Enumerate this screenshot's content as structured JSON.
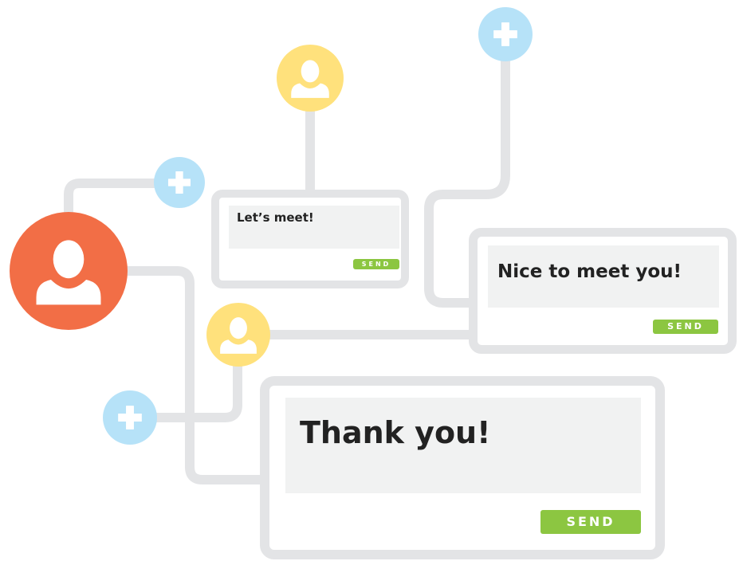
{
  "colors": {
    "connector": "#e3e4e6",
    "card_border": "#e3e4e6",
    "message_bg": "#f1f2f2",
    "send_button": "#8cc641",
    "main_avatar": "#f26e46",
    "contact_avatar": "#ffe17c",
    "add_node": "#b6e2f8"
  },
  "cards": [
    {
      "message": "Let’s meet!",
      "send_label": "SEND"
    },
    {
      "message": "Nice to meet you!",
      "send_label": "SEND"
    },
    {
      "message": "Thank you!",
      "send_label": "SEND"
    }
  ],
  "icons": {
    "main_user": "user-icon",
    "contact": "user-icon",
    "add": "plus-icon"
  }
}
